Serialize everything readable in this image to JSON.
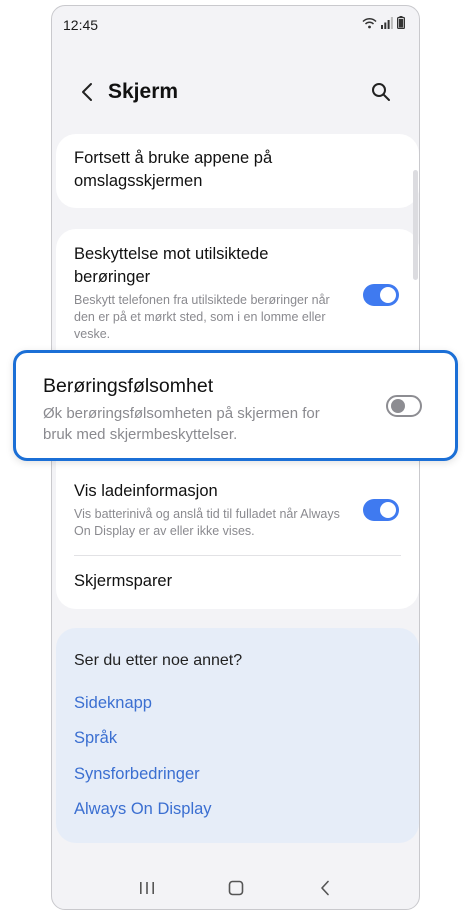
{
  "status_bar": {
    "time": "12:45",
    "icons": [
      "wifi-icon",
      "signal-icon",
      "battery-icon"
    ]
  },
  "app_bar": {
    "title": "Skjerm",
    "back_icon": "chevron-left-icon",
    "search_icon": "search-icon"
  },
  "settings": {
    "cover_screen": {
      "title": "Fortsett å bruke appene på omslagsskjermen"
    },
    "accidental_touch": {
      "title": "Beskyttelse mot utilsiktede berøringer",
      "subtitle": "Beskytt telefonen fra utilsiktede berøringer når den er på et mørkt sted, som i en lomme eller veske.",
      "enabled": true
    },
    "touch_sensitivity": {
      "title": "Berøringsfølsomhet",
      "subtitle": "Øk berøringsfølsomheten på skjermen for bruk med skjermbeskyttelser.",
      "enabled": false
    },
    "charging_info": {
      "title": "Vis ladeinformasjon",
      "subtitle": "Vis batterinivå og anslå tid til fulladet når Always On Display er av eller ikke vises.",
      "enabled": true
    },
    "screensaver": {
      "title": "Skjermsparer"
    }
  },
  "suggestions": {
    "title": "Ser du etter noe annet?",
    "links": [
      "Sideknapp",
      "Språk",
      "Synsforbedringer",
      "Always On Display"
    ]
  },
  "nav_bar": {
    "icons": [
      "recents-icon",
      "home-icon",
      "back-icon"
    ]
  },
  "colors": {
    "accent": "#3f7af0",
    "link": "#3b6fd1",
    "highlight_border": "#1b6fd6",
    "background": "#f3f3f6"
  }
}
